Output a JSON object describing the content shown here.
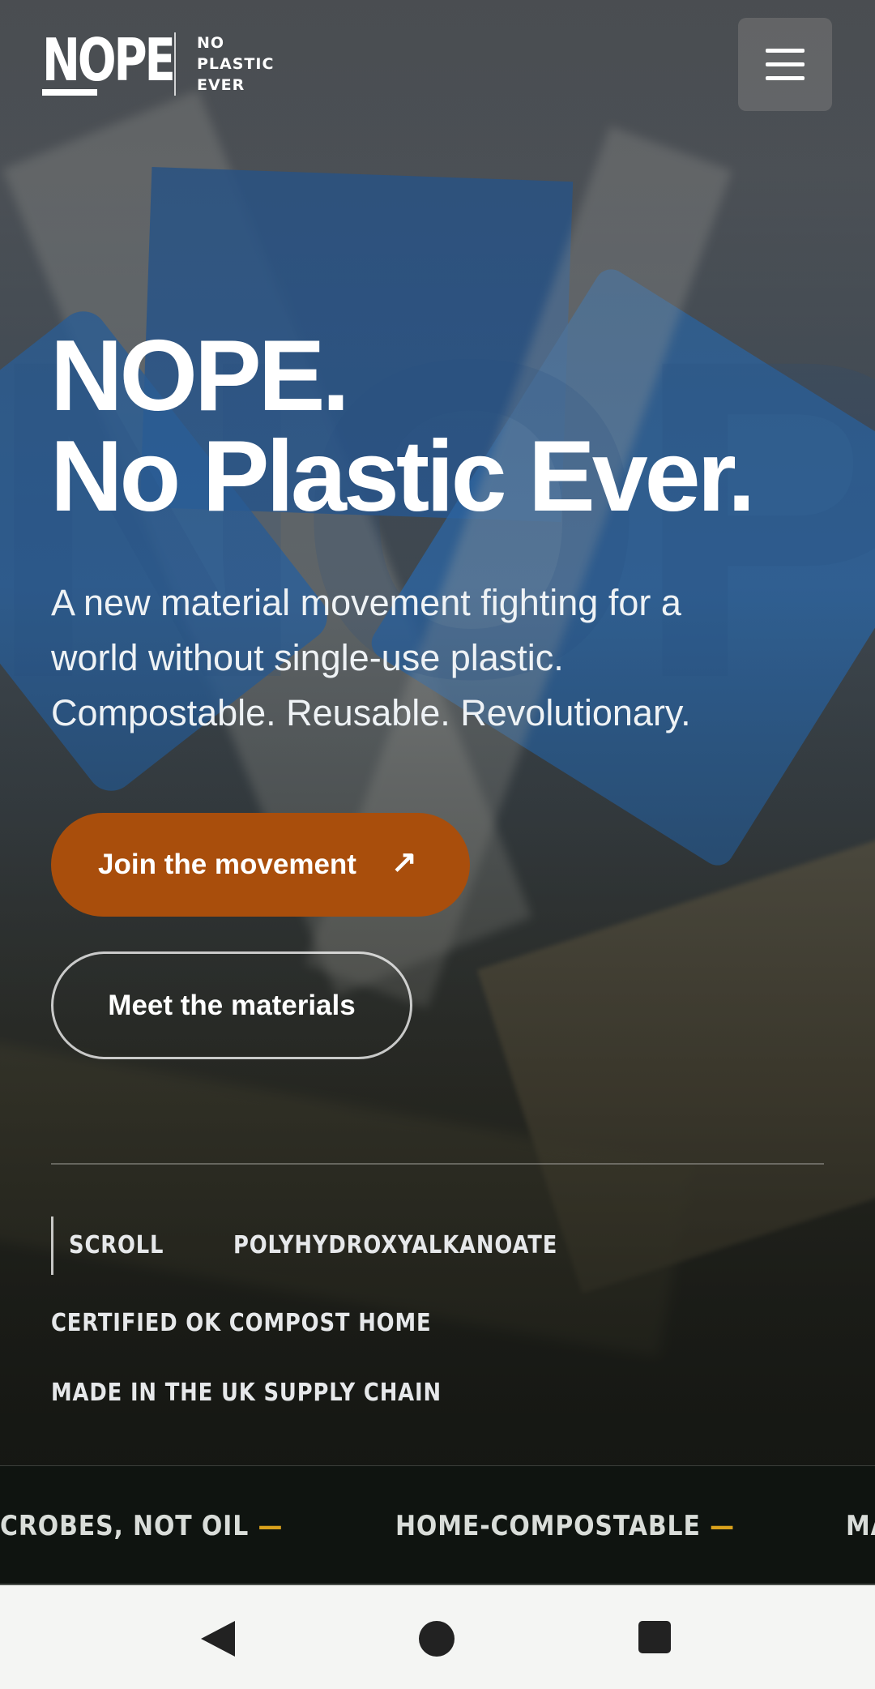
{
  "header": {
    "logo_word": "NOPE",
    "logo_tagline": [
      "NO",
      "PLASTIC",
      "EVER"
    ],
    "menu_icon": "hamburger-menu-icon"
  },
  "hero": {
    "headline_line1": "NOPE.",
    "headline_line2": "No Plastic Ever.",
    "subheadline": "A new material movement fighting for a world without single-use plastic. Compostable. Reusable. Revolutionary.",
    "primary_cta": "Join the movement",
    "primary_cta_icon": "arrow-up-right-icon",
    "secondary_cta": "Meet the materials",
    "scroll_label": "SCROLL",
    "facts": [
      "POLYHYDROXYALKANOATE",
      "CERTIFIED OK COMPOST HOME",
      "MADE IN THE UK SUPPLY CHAIN"
    ]
  },
  "ticker": {
    "items": [
      "CROBES, NOT OIL",
      "HOME-COMPOSTABLE",
      "MA"
    ],
    "separator": "—"
  },
  "system_nav": {
    "back_icon": "back-triangle-icon",
    "home_icon": "home-circle-icon",
    "recents_icon": "recents-square-icon"
  },
  "colors": {
    "accent": "#a94e0c",
    "ticker_bg": "#0f1410",
    "ticker_dash": "#d9a11c"
  }
}
